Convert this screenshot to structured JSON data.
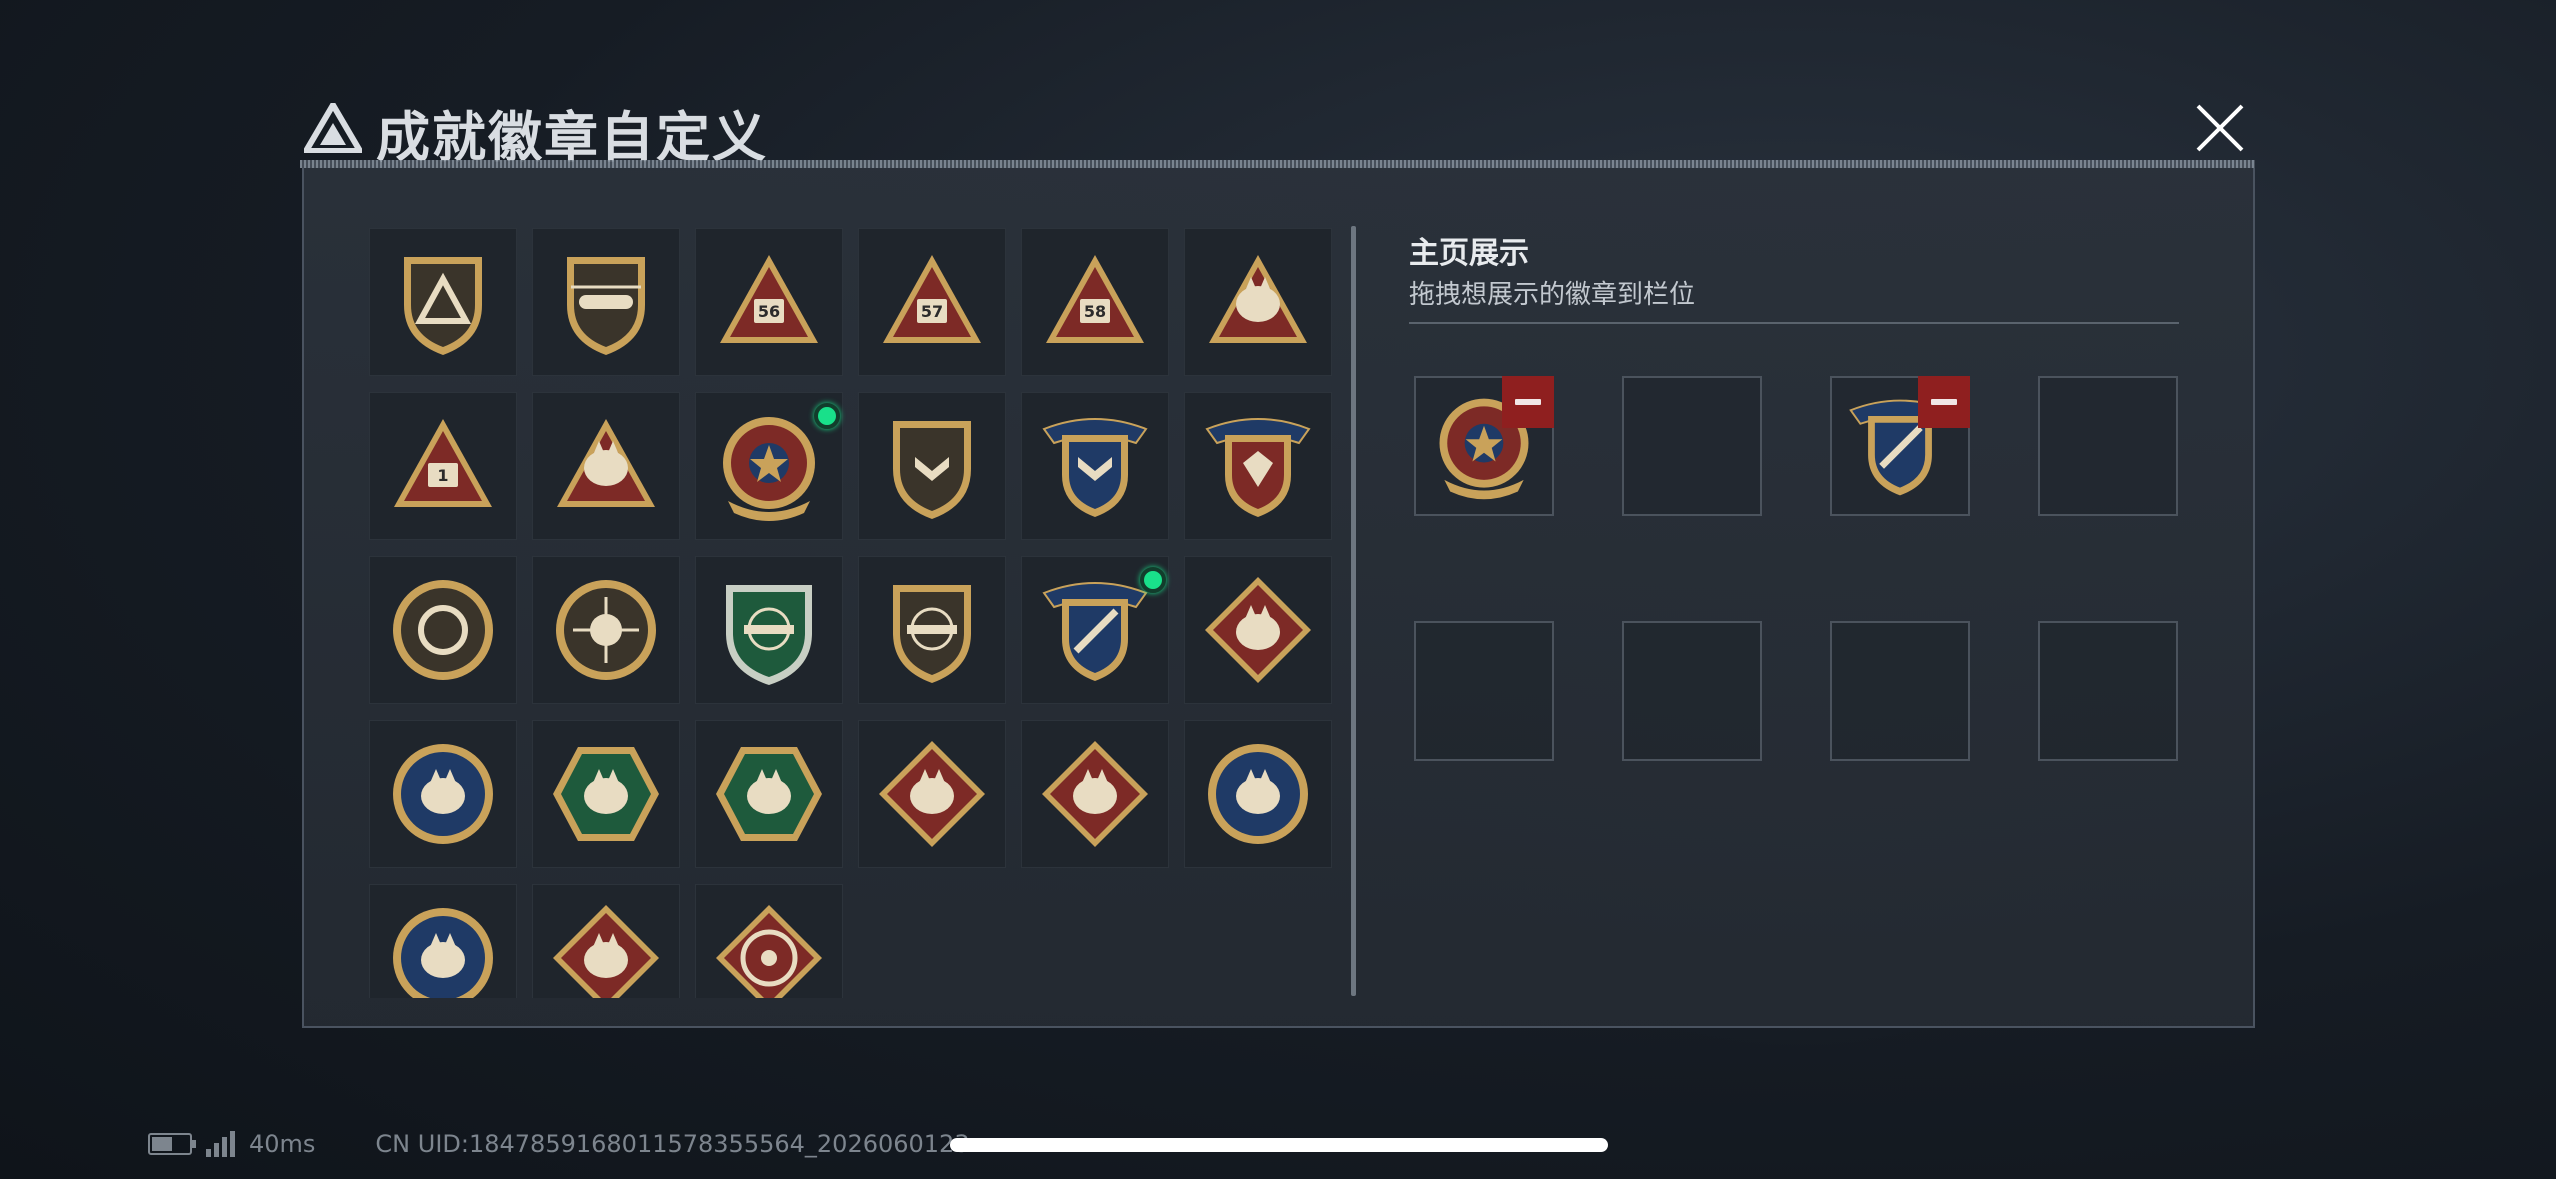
{
  "header": {
    "title": "成就徽章自定义",
    "close_icon": "close-icon",
    "logo_icon": "delta-triangle-logo-icon"
  },
  "badges": [
    {
      "icon": "delta-shield-badge-icon",
      "is_new": false
    },
    {
      "icon": "helicopter-shield-badge-icon",
      "is_new": false
    },
    {
      "icon": "triangle-56-badge-icon",
      "label": "56",
      "is_new": false
    },
    {
      "icon": "triangle-57-badge-icon",
      "label": "57",
      "is_new": false
    },
    {
      "icon": "triangle-58-badge-icon",
      "label": "58",
      "is_new": false
    },
    {
      "icon": "triangle-nest-badge-icon",
      "is_new": false
    },
    {
      "icon": "triangle-1-badge-icon",
      "label": "1",
      "is_new": false
    },
    {
      "icon": "triangle-soldiers-badge-icon",
      "is_new": false
    },
    {
      "icon": "star-medal-badge-icon",
      "is_new": true
    },
    {
      "icon": "chevron-shield-badge-icon",
      "is_new": false
    },
    {
      "icon": "winged-shield-badge-icon",
      "is_new": false
    },
    {
      "icon": "gem-shield-badge-icon",
      "is_new": false
    },
    {
      "icon": "ring-round-badge-icon",
      "is_new": false
    },
    {
      "icon": "crosshair-round-badge-icon",
      "is_new": false
    },
    {
      "icon": "green-rifle-shield-badge-icon",
      "is_new": false
    },
    {
      "icon": "pistol-shield-badge-icon",
      "is_new": false
    },
    {
      "icon": "missile-shield-badge-icon",
      "is_new": true
    },
    {
      "icon": "wolf-diamond-badge-icon",
      "is_new": false
    },
    {
      "icon": "eagle-round-badge-icon",
      "is_new": false
    },
    {
      "icon": "wasp-hexagon-badge-icon",
      "is_new": false
    },
    {
      "icon": "wasp-hexagon-alt-badge-icon",
      "is_new": false
    },
    {
      "icon": "dragon-diamond-badge-icon",
      "is_new": false
    },
    {
      "icon": "runner-diamond-badge-icon",
      "is_new": false
    },
    {
      "icon": "lynx-round-badge-icon",
      "is_new": false
    },
    {
      "icon": "wolf-round-badge-icon",
      "is_new": false
    },
    {
      "icon": "lizard-diamond-badge-icon",
      "is_new": false
    },
    {
      "icon": "wheel-diamond-badge-icon",
      "is_new": false
    }
  ],
  "showcase": {
    "title": "主页展示",
    "subtitle": "拖拽想展示的徽章到栏位",
    "slots": [
      {
        "badge": "star-medal-badge-icon"
      },
      {
        "badge": null
      },
      {
        "badge": "missile-shield-badge-icon"
      },
      {
        "badge": null
      },
      {
        "badge": null
      },
      {
        "badge": null
      },
      {
        "badge": null
      },
      {
        "badge": null
      }
    ]
  },
  "status": {
    "ping": "40ms",
    "uid": "CN UID:1847859168011578355564_2026060123",
    "battery_icon": "battery-icon",
    "signal_icon": "signal-icon"
  },
  "colors": {
    "gold": "#c9a25a",
    "dark_red": "#7d2a26",
    "navy": "#1f3a66",
    "green": "#1e5a3c",
    "new_dot": "#19e08a",
    "remove": "#8f1f1f"
  }
}
